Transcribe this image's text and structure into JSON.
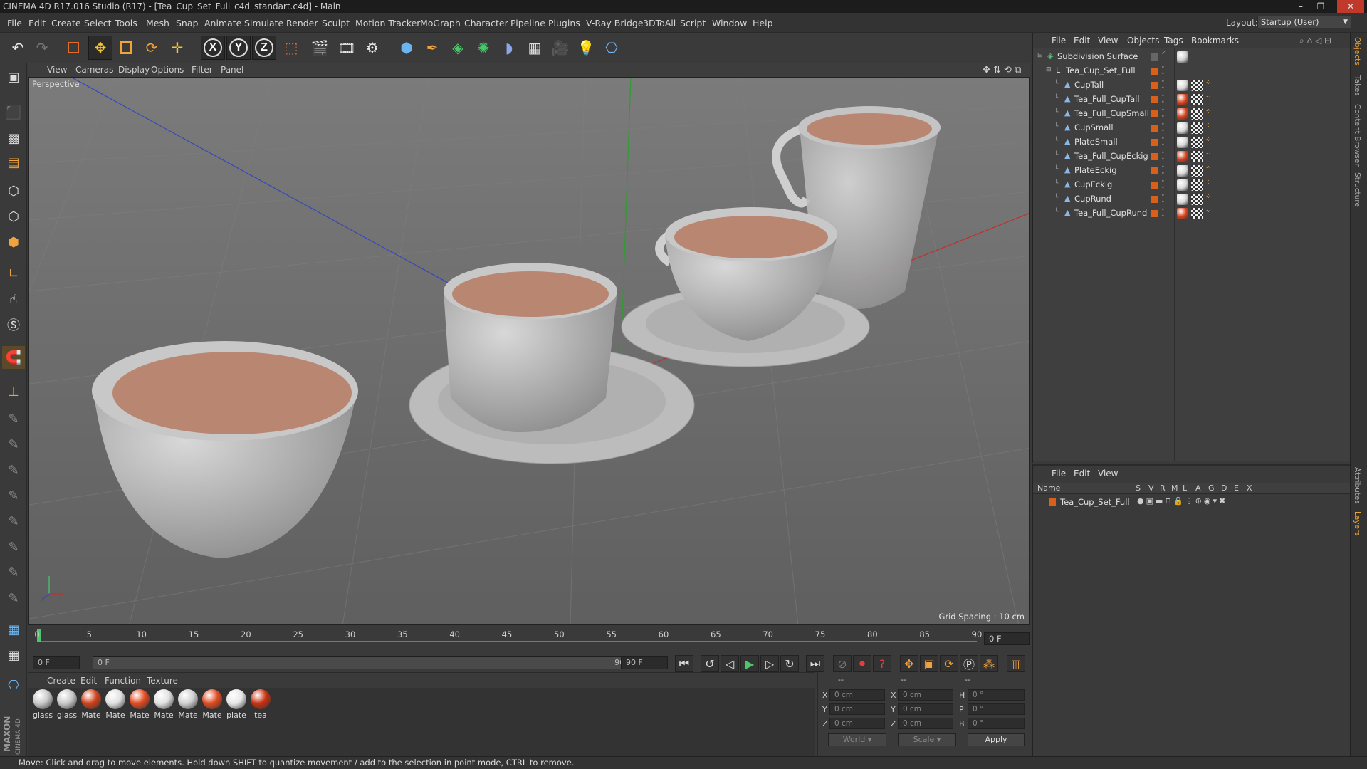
{
  "window": {
    "title": "CINEMA 4D R17.016 Studio (R17) - [Tea_Cup_Set_Full_c4d_standart.c4d] - Main",
    "controls": [
      "–",
      "❐",
      "✕"
    ]
  },
  "menubar": {
    "items": [
      "File",
      "Edit",
      "Create",
      "Select",
      "Tools",
      "Mesh",
      "Snap",
      "Animate",
      "Simulate",
      "Render",
      "Sculpt",
      "Motion Tracker",
      "MoGraph",
      "Character",
      "Pipeline",
      "Plugins",
      "V-Ray Bridge",
      "3DToAll",
      "Script",
      "Window",
      "Help"
    ],
    "layout_label": "Layout:",
    "layout_value": "Startup (User)"
  },
  "toolbar": {
    "axis_x": "X",
    "axis_y": "Y",
    "axis_z": "Z"
  },
  "viewport": {
    "menu": [
      "View",
      "Cameras",
      "Display",
      "Options",
      "Filter",
      "Panel"
    ],
    "label": "Perspective",
    "grid_spacing": "Grid Spacing : 10 cm"
  },
  "timeline": {
    "ticks": [
      "0",
      "5",
      "10",
      "15",
      "20",
      "25",
      "30",
      "35",
      "40",
      "45",
      "50",
      "55",
      "60",
      "65",
      "70",
      "75",
      "80",
      "85",
      "90"
    ],
    "current_frame": "0 F",
    "start_field": "0 F",
    "range_start": "0 F",
    "range_end": "90 F",
    "end_field": "90 F"
  },
  "materials": {
    "menu": [
      "Create",
      "Edit",
      "Function",
      "Texture"
    ],
    "items": [
      {
        "label": "glass",
        "color": "#c8c8c8"
      },
      {
        "label": "glass",
        "color": "#c8c8c8"
      },
      {
        "label": "Mate",
        "color": "#d0401a"
      },
      {
        "label": "Mate",
        "color": "#e0e0e0"
      },
      {
        "label": "Mate",
        "color": "#e04a20"
      },
      {
        "label": "Mate",
        "color": "#e0e0e0"
      },
      {
        "label": "Mate",
        "color": "#cfcfcf"
      },
      {
        "label": "Mate",
        "color": "#e04a20"
      },
      {
        "label": "plate",
        "color": "#e6e6e6"
      },
      {
        "label": "tea",
        "color": "#c8300f"
      }
    ]
  },
  "coordinates": {
    "header": [
      "--",
      "--",
      "--"
    ],
    "rows": [
      {
        "pos_label": "X",
        "pos": "0 cm",
        "size_label": "X",
        "size": "0 cm",
        "rot_label": "H",
        "rot": "0 °"
      },
      {
        "pos_label": "Y",
        "pos": "0 cm",
        "size_label": "Y",
        "size": "0 cm",
        "rot_label": "P",
        "rot": "0 °"
      },
      {
        "pos_label": "Z",
        "pos": "0 cm",
        "size_label": "Z",
        "size": "0 cm",
        "rot_label": "B",
        "rot": "0 °"
      }
    ],
    "space": "World",
    "mode": "Scale",
    "apply": "Apply"
  },
  "object_manager": {
    "menu": [
      "File",
      "Edit",
      "View",
      "Objects",
      "Tags",
      "Bookmarks"
    ],
    "objects": [
      {
        "name": "Subdivision Surface",
        "level": 0,
        "tag_color": "#cfcfcf"
      },
      {
        "name": "Tea_Cup_Set_Full",
        "level": 1,
        "tag_color": ""
      },
      {
        "name": "CupTall",
        "level": 2,
        "tag_color": "#d8d8d8"
      },
      {
        "name": "Tea_Full_CupTall",
        "level": 2,
        "tag_color": "#d8401a"
      },
      {
        "name": "Tea_Full_CupSmall",
        "level": 2,
        "tag_color": "#d8401a"
      },
      {
        "name": "CupSmall",
        "level": 2,
        "tag_color": "#d8d8d8"
      },
      {
        "name": "PlateSmall",
        "level": 2,
        "tag_color": "#d8d8d8"
      },
      {
        "name": "Tea_Full_CupEckig",
        "level": 2,
        "tag_color": "#d8401a"
      },
      {
        "name": "PlateEckig",
        "level": 2,
        "tag_color": "#d8d8d8"
      },
      {
        "name": "CupEckig",
        "level": 2,
        "tag_color": "#d8d8d8"
      },
      {
        "name": "CupRund",
        "level": 2,
        "tag_color": "#d8d8d8"
      },
      {
        "name": "Tea_Full_CupRund",
        "level": 2,
        "tag_color": "#d8401a"
      }
    ]
  },
  "layer_manager": {
    "menu": [
      "File",
      "Edit",
      "View"
    ],
    "columns": [
      "Name",
      "S",
      "V",
      "R",
      "M",
      "L",
      "A",
      "G",
      "D",
      "E",
      "X"
    ],
    "layers": [
      {
        "name": "Tea_Cup_Set_Full",
        "color": "#d8601a"
      }
    ]
  },
  "right_tabs": [
    "Objects",
    "Takes",
    "Content Browser",
    "Structure",
    "Attributes",
    "Layers"
  ],
  "status": "Move: Click and drag to move elements. Hold down SHIFT to quantize movement / add to the selection in point mode, CTRL to remove.",
  "branding": "MAXON CINEMA 4D",
  "colors": {
    "accent": "#e8a43a",
    "tea": "#b86a52",
    "selection_orange": "#d8601a"
  }
}
